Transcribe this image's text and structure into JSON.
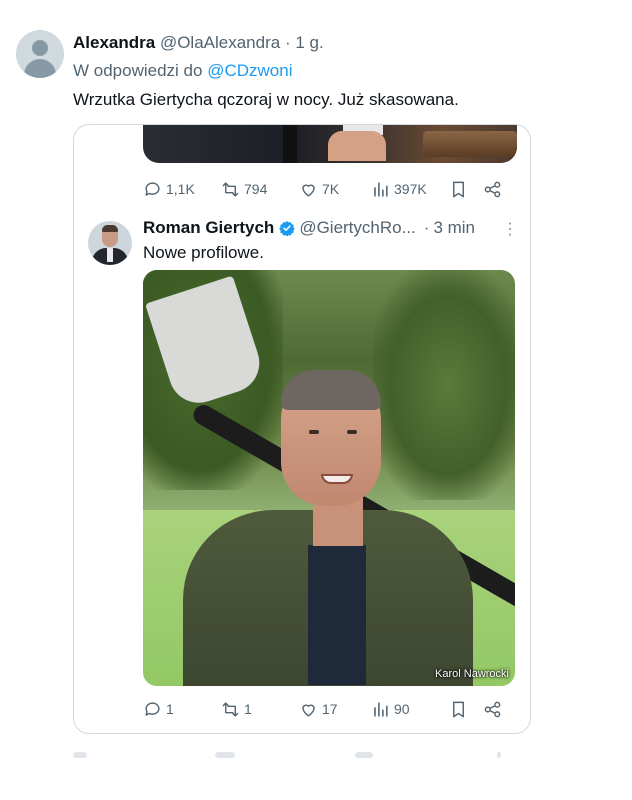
{
  "outer_tweet": {
    "name": "Alexandra",
    "handle": "@OlaAlexandra",
    "separator": "·",
    "time": "1 g.",
    "reply_prefix": "W odpowiedzi do",
    "reply_mention": "@CDzwoni",
    "text": "Wrzutka Giertycha qczoraj w nocy. Już skasowana."
  },
  "prev_tweet_actions": {
    "replies": "1,1K",
    "retweets": "794",
    "likes": "7K",
    "views": "397K"
  },
  "quoted_tweet": {
    "name": "Roman Giertych",
    "handle": "@GiertychRo...",
    "separator": "·",
    "time": "3 min",
    "more": "⋮",
    "text": "Nowe profilowe.",
    "photo_credit": "Karol Nawrocki",
    "actions": {
      "replies": "1",
      "retweets": "1",
      "likes": "17",
      "views": "90"
    }
  },
  "colors": {
    "muted": "#536471",
    "mention": "#1d9bf0",
    "verified": "#1d9bf0",
    "border": "#cfd9de"
  }
}
